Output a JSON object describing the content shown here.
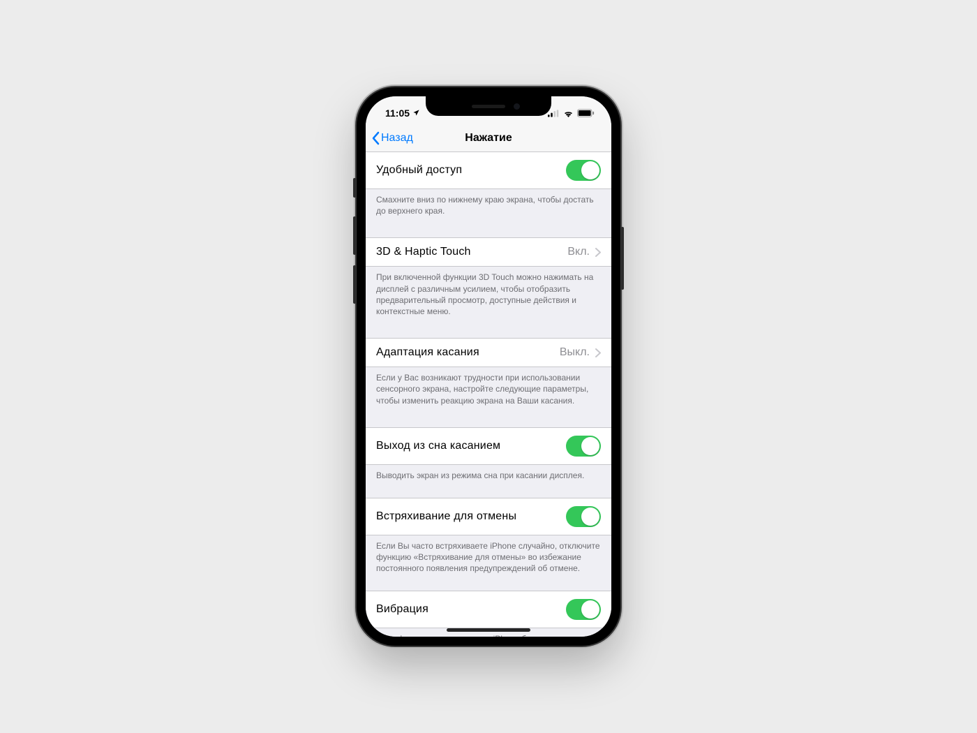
{
  "status": {
    "time": "11:05",
    "location_icon": "location-arrow",
    "signal_icon": "cellular-signal",
    "wifi_icon": "wifi",
    "battery_icon": "battery-full"
  },
  "nav": {
    "back_label": "Назад",
    "title": "Нажатие"
  },
  "sections": {
    "reachability": {
      "label": "Удобный доступ",
      "toggle_on": true,
      "footer": "Смахните вниз по нижнему краю экрана, чтобы достать до верхнего края."
    },
    "haptic": {
      "label": "3D & Haptic Touch",
      "value": "Вкл.",
      "footer": "При включенной функции 3D Touch можно нажимать на дисплей с различным усилием, чтобы отобразить предварительный просмотр, доступные действия и контекстные меню."
    },
    "touch_accom": {
      "label": "Адаптация касания",
      "value": "Выкл.",
      "footer": "Если у Вас возникают трудности при использовании сенсорного экрана, настройте следующие параметры, чтобы изменить реакцию экрана на Ваши касания."
    },
    "tap_wake": {
      "label": "Выход из сна касанием",
      "toggle_on": true,
      "footer": "Выводить экран из режима сна при касании дисплея."
    },
    "shake_undo": {
      "label": "Встряхивание для отмены",
      "toggle_on": true,
      "footer": "Если Вы часто встряхиваете iPhone случайно, отключите функцию «Встряхивание для отмены» во избежание постоянного появления предупреждений об отмене."
    },
    "vibration": {
      "label": "Вибрация",
      "toggle_on": true,
      "footer": "Если функция выключена, на iPhone будут отключены все типы вибраций, в том числе вибрация уведомлений о землетрясениях, цунами и других экстренных ситуациях."
    }
  }
}
